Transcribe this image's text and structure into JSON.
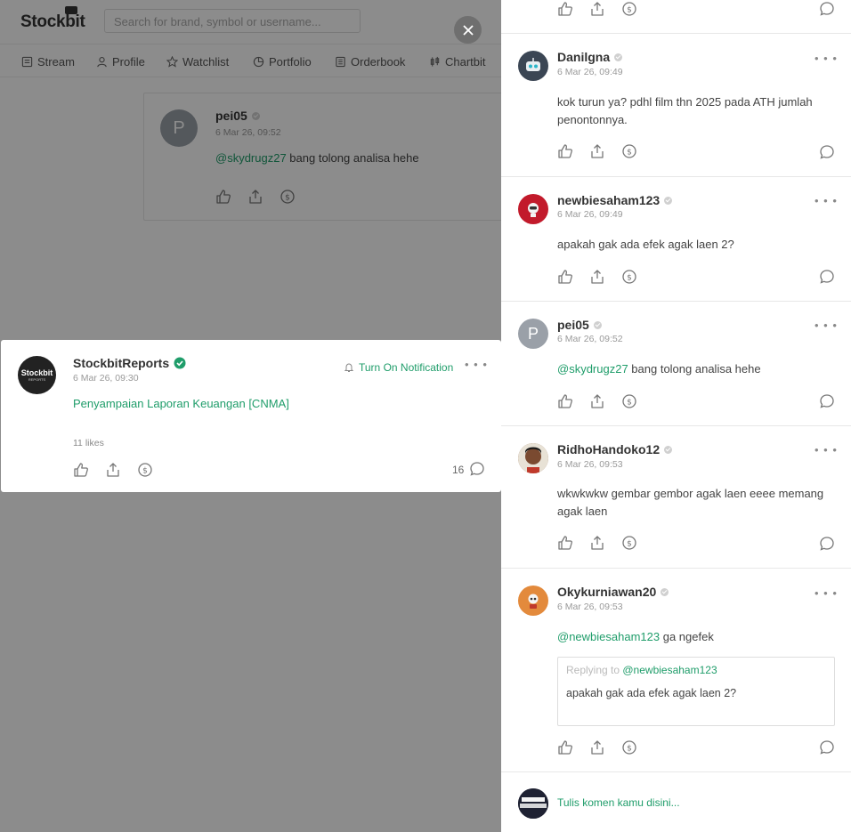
{
  "app": {
    "logo": "Stockbit",
    "search_placeholder": "Search for brand, symbol or username..."
  },
  "nav": [
    {
      "label": "Stream",
      "icon": "stream-icon"
    },
    {
      "label": "Profile",
      "icon": "profile-icon"
    },
    {
      "label": "Watchlist",
      "icon": "star-icon"
    },
    {
      "label": "Portfolio",
      "icon": "pie-icon"
    },
    {
      "label": "Orderbook",
      "icon": "orderbook-icon"
    },
    {
      "label": "Chartbit",
      "icon": "candlestick-icon"
    }
  ],
  "background_post": {
    "avatar_letter": "P",
    "username": "pei05",
    "timestamp": "6 Mar 26, 09:52",
    "mention": "@skydrugz27",
    "text": " bang tolong analisa hehe"
  },
  "post": {
    "avatar_text": "Stockbit",
    "avatar_sub": "REPORTS",
    "username": "StockbitReports",
    "verified": true,
    "timestamp": "6 Mar 26, 09:30",
    "notification_label": "Turn On Notification",
    "title": "Penyampaian Laporan Keuangan [CNMA]",
    "likes": "11 likes",
    "reply_count": "16",
    "accent_color": "#1f9d6a"
  },
  "comments": [
    {
      "username": "Danilgna",
      "timestamp": "6 Mar 26, 09:49",
      "text": "kok turun ya? pdhl film thn 2025 pada ATH jumlah penontonnya.",
      "avatar": "robot-avatar"
    },
    {
      "username": "newbiesaham123",
      "timestamp": "6 Mar 26, 09:49",
      "text": "apakah gak ada efek agak laen 2?",
      "avatar": "red-robot-avatar"
    },
    {
      "username": "pei05",
      "timestamp": "6 Mar 26, 09:52",
      "mention": "@skydrugz27",
      "text": " bang tolong analisa hehe",
      "avatar": "P"
    },
    {
      "username": "RidhoHandoko12",
      "timestamp": "6 Mar 26, 09:53",
      "text": "wkwkwkw gembar gembor agak laen eeee memang agak laen",
      "avatar": "photo-avatar"
    },
    {
      "username": "Okykurniawan20",
      "timestamp": "6 Mar 26, 09:53",
      "mention": "@newbiesaham123",
      "text": " ga ngefek",
      "avatar": "orange-robot-avatar",
      "quote": {
        "replying_to_label": "Replying to ",
        "replying_to_user": "@newbiesaham123",
        "text": "apakah gak ada efek agak laen 2?"
      }
    }
  ],
  "composer": {
    "placeholder": "Tulis komen kamu disini..."
  }
}
